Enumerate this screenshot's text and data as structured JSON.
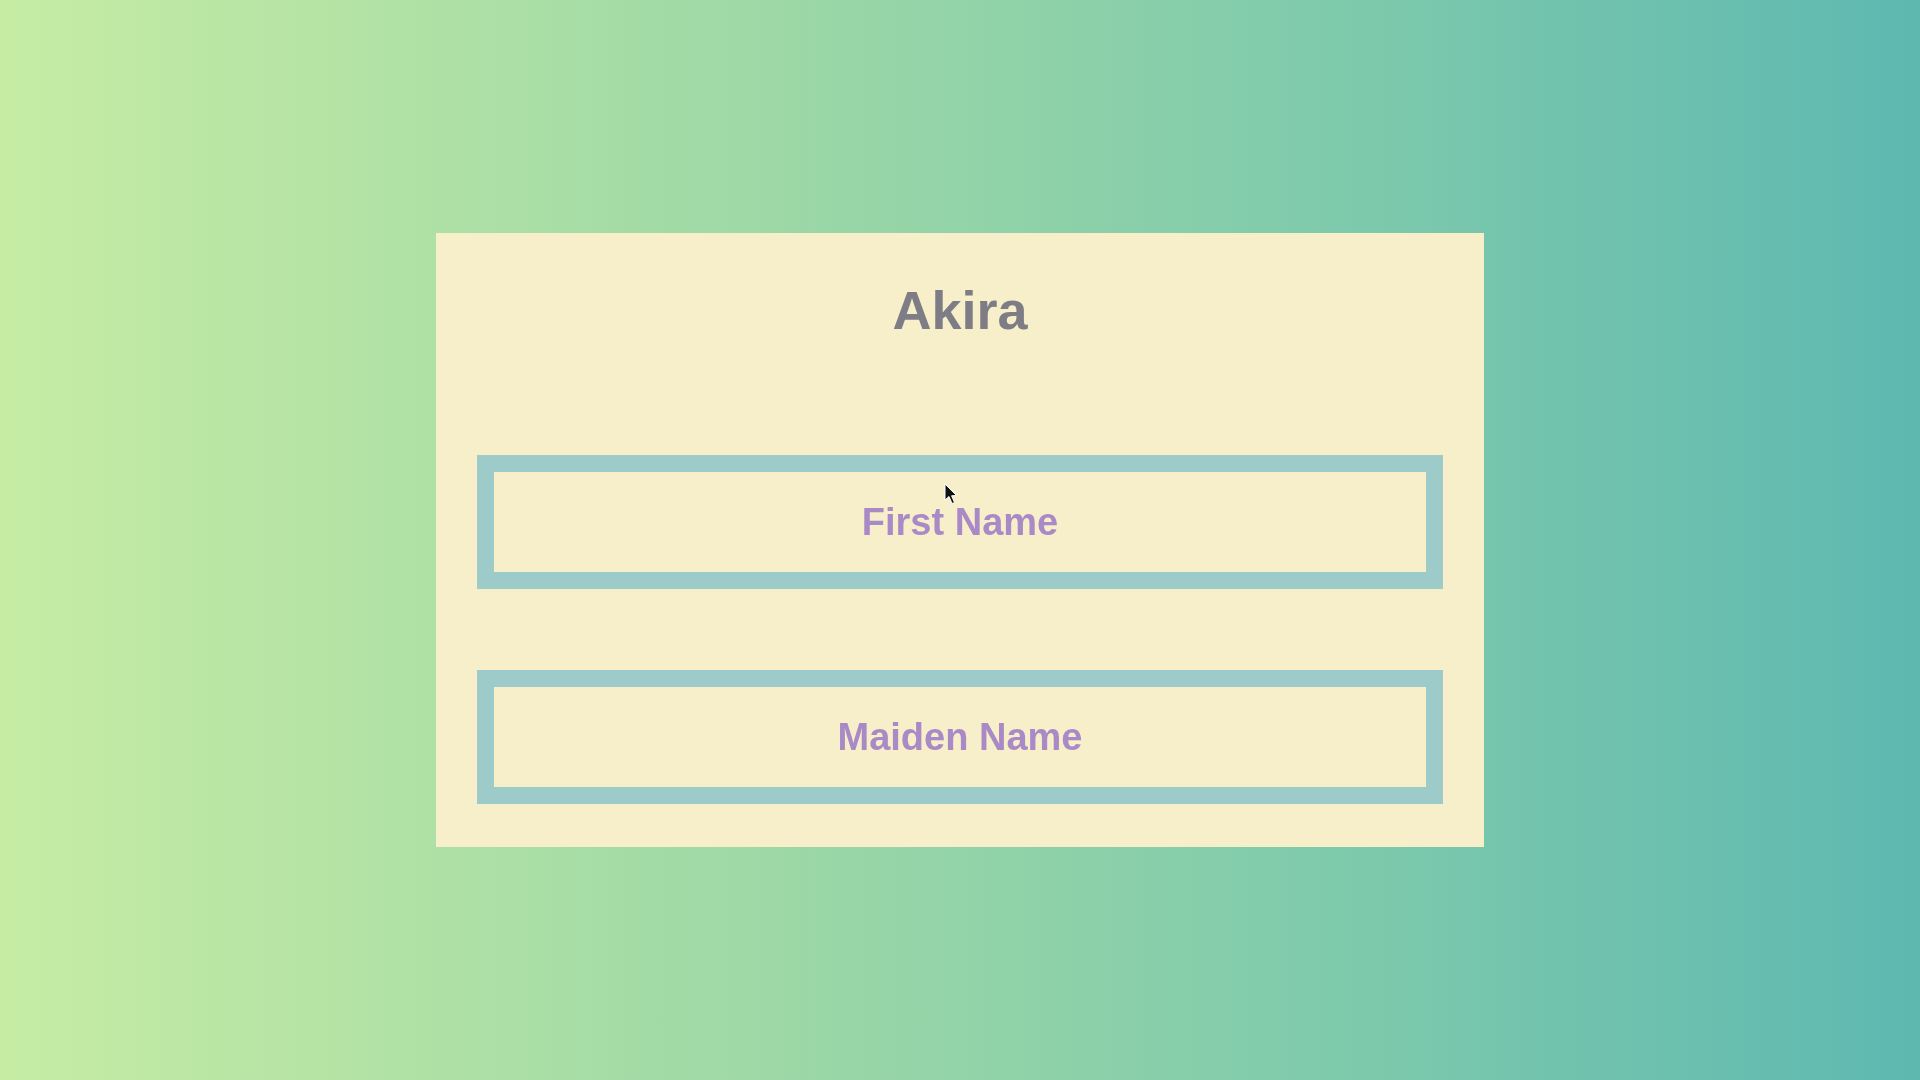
{
  "title": "Akira",
  "fields": [
    {
      "placeholder": "First Name"
    },
    {
      "placeholder": "Maiden Name"
    }
  ]
}
